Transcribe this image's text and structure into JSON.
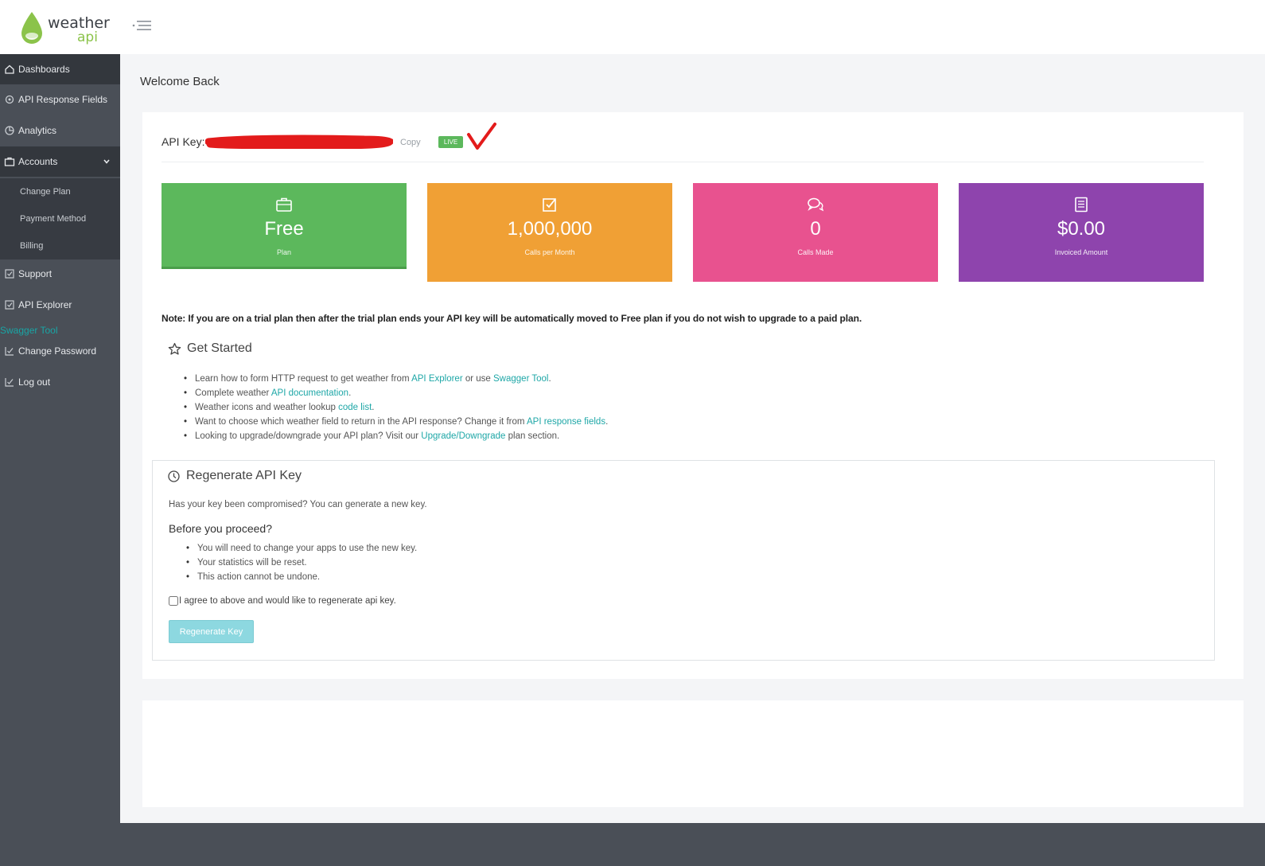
{
  "brand": {
    "word1": "weather",
    "word2": "api",
    "accent": "#8bc34a"
  },
  "sidebar": {
    "items": [
      {
        "label": "Dashboards",
        "icon": "home-icon"
      },
      {
        "label": "API Response Fields",
        "icon": "gear-icon"
      },
      {
        "label": "Analytics",
        "icon": "chart-icon"
      },
      {
        "label": "Accounts",
        "icon": "briefcase-icon"
      },
      {
        "label": "Support",
        "icon": "edit-icon"
      },
      {
        "label": "API Explorer",
        "icon": "edit-icon"
      },
      {
        "label": "Change Password",
        "icon": "edit-icon"
      },
      {
        "label": "Log out",
        "icon": "edit-icon"
      }
    ],
    "sub_items": [
      {
        "label": "Change Plan"
      },
      {
        "label": "Payment Method"
      },
      {
        "label": "Billing"
      }
    ],
    "swagger_link": "Swagger Tool"
  },
  "main": {
    "welcome": "Welcome Back",
    "api_key_label": "API Key:",
    "copy_label": "Copy",
    "live_badge": "LIVE",
    "tiles": [
      {
        "value": "Free",
        "label": "Plan",
        "color": "#5cb85c",
        "icon": "briefcase-icon"
      },
      {
        "value": "1,000,000",
        "label": "Calls per Month",
        "color": "#f0a035",
        "icon": "checkbox-icon"
      },
      {
        "value": "0",
        "label": "Calls Made",
        "color": "#e8528f",
        "icon": "chat-icon"
      },
      {
        "value": "$0.00",
        "label": "Invoiced Amount",
        "color": "#8e44ad",
        "icon": "document-icon"
      }
    ],
    "note": "Note: If you are on a trial plan then after the trial plan ends your API key will be automatically moved to Free plan if you do not wish to upgrade to a paid plan.",
    "get_started": {
      "title": "Get Started",
      "items": [
        {
          "pre": "Learn how to form HTTP request to get weather from ",
          "link1": "API Explorer",
          "mid": " or use ",
          "link2": "Swagger Tool",
          "post": "."
        },
        {
          "pre": "Complete weather ",
          "link1": "API documentation",
          "post": "."
        },
        {
          "pre": "Weather icons and weather lookup ",
          "link1": "code list",
          "post": "."
        },
        {
          "pre": "Want to choose which weather field to return in the API response? Change it from ",
          "link1": "API response fields",
          "post": "."
        },
        {
          "pre": "Looking to upgrade/downgrade your API plan? Visit our ",
          "link1": "Upgrade/Downgrade",
          "post": " plan section."
        }
      ]
    },
    "regenerate": {
      "title": "Regenerate API Key",
      "question": "Has your key been compromised? You can generate a new key.",
      "proceed_title": "Before you proceed?",
      "items": [
        "You will need to change your apps to use the new key.",
        "Your statistics will be reset.",
        "This action cannot be undone."
      ],
      "agree_label": "I agree to above and would like to regenerate api key.",
      "button_label": "Regenerate Key"
    }
  }
}
